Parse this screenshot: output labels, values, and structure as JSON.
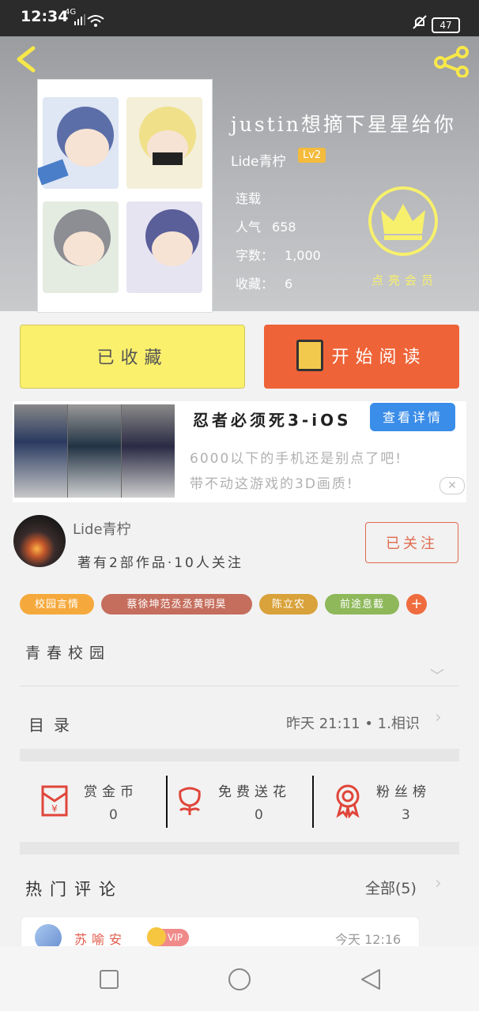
{
  "status_bar": {
    "time": "12:34",
    "network": "4G",
    "battery": "47"
  },
  "book": {
    "title": "justin想摘下星星给你",
    "author": "Lide青柠",
    "level": "Lv2",
    "status": "连载",
    "popularity_label": "人气",
    "popularity_value": "658",
    "words_label": "字数：",
    "words_value": "1,000",
    "collections_label": "收藏：",
    "collections_value": "6",
    "vip_label": "点亮会员"
  },
  "actions": {
    "collected_label": "已收藏",
    "read_label": "开始阅读"
  },
  "ad": {
    "title": "忍者必须死3-iOS",
    "detail_button": "查看详情",
    "desc_line1": "6000以下的手机还是别点了吧!",
    "desc_line2": "带不动这游戏的3D画质!"
  },
  "author_card": {
    "name": "Lide青柠",
    "stats": "著有2部作品·10人关注",
    "follow_label": "已关注"
  },
  "tags": [
    {
      "label": "校园言情",
      "color": "#f5a93c"
    },
    {
      "label": "蔡徐坤范丞丞黄明昊",
      "color": "#c56e5d"
    },
    {
      "label": "陈立农",
      "color": "#d9a23a"
    },
    {
      "label": "前途息截",
      "color": "#8eb85a"
    }
  ],
  "tag_add": "+",
  "category": "青春校园",
  "catalog": {
    "label": "目录",
    "update_info": "昨天 21:11 • 1.相识"
  },
  "rewards": [
    {
      "label": "赏金币",
      "value": "0"
    },
    {
      "label": "免费送花",
      "value": "0"
    },
    {
      "label": "粉丝榜",
      "value": "3"
    }
  ],
  "comments": {
    "section_label": "热门评论",
    "all_label": "全部(5)",
    "first": {
      "name": "苏喻安",
      "badge": "VIP",
      "time": "今天 12:16"
    }
  },
  "colors": {
    "accent_orange": "#ee6337",
    "collect_yellow": "#faf06c",
    "vip_yellow": "#f7f06c",
    "link_blue": "#3a8de8"
  },
  "icons": [
    "back-arrow-icon",
    "share-icon",
    "crown-icon",
    "book-icon",
    "red-envelope-icon",
    "flower-icon",
    "medal-icon"
  ]
}
